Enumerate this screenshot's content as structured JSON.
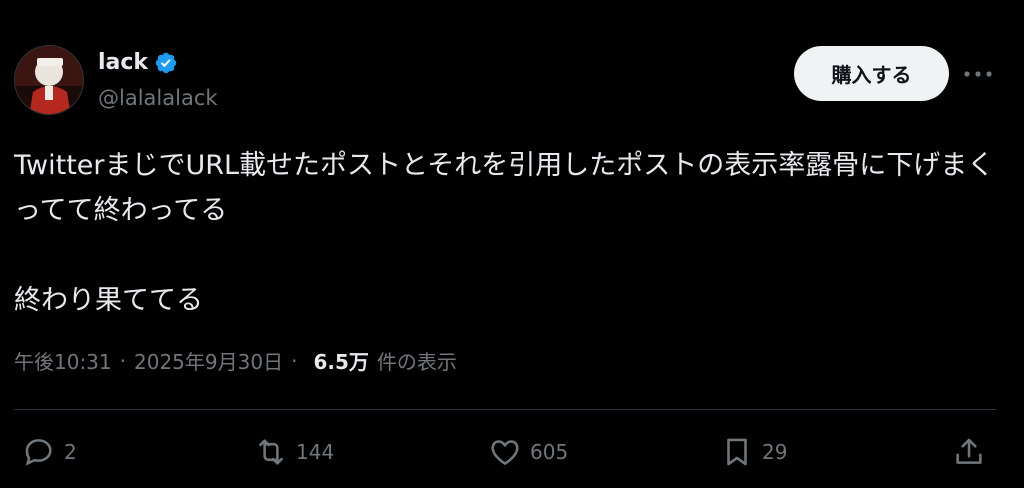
{
  "author": {
    "display_name": "lack",
    "handle": "@lalalalack",
    "verified": true,
    "avatar_icon": "avatar-photo"
  },
  "header": {
    "buy_label": "購入する",
    "more_icon": "more-horizontal-icon"
  },
  "post": {
    "line1": "TwitterまじでURL載せたポストとそれを引用したポストの表示率露骨に下げまくってて終わってる",
    "line2": "終わり果ててる"
  },
  "meta": {
    "time": "午後10:31",
    "separator": "·",
    "date": "2025年9月30日",
    "views_count": "6.5万",
    "views_label": "件の表示"
  },
  "actions": {
    "replies": "2",
    "reposts": "144",
    "likes": "605",
    "bookmarks": "29"
  },
  "colors": {
    "background": "#000000",
    "text": "#e7e9ea",
    "muted": "#71767b",
    "verified": "#1d9bf0",
    "button_bg": "#eff3f4"
  }
}
